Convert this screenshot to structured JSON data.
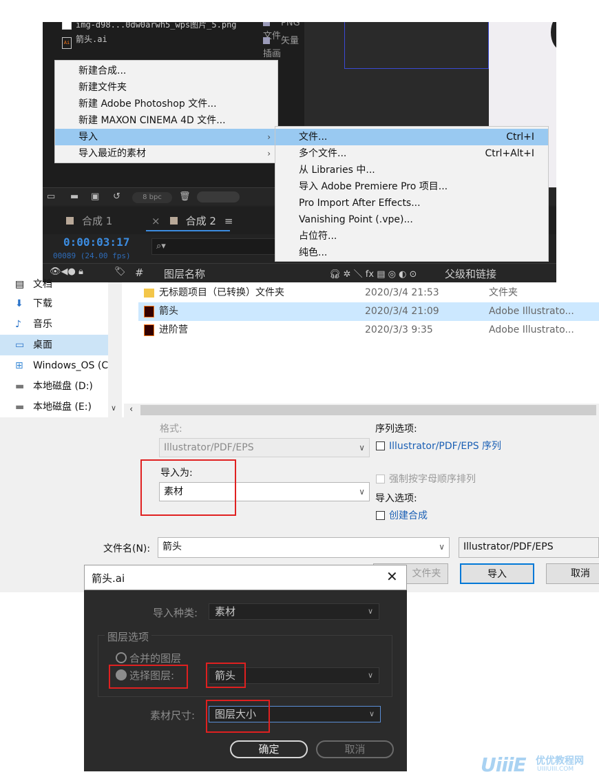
{
  "ae": {
    "project_files": [
      {
        "name": "img-d98...0dw0arwh5_wps图片_5.png",
        "type": "PNG 文件"
      },
      {
        "name": "箭头.ai",
        "type": "矢量插画"
      }
    ],
    "context_menu": [
      "新建合成...",
      "新建文件夹",
      "新建 Adobe Photoshop 文件...",
      "新建 MAXON CINEMA 4D 文件...",
      "导入",
      "导入最近的素材"
    ],
    "submenu": [
      {
        "label": "文件...",
        "shortcut": "Ctrl+I"
      },
      {
        "label": "多个文件...",
        "shortcut": "Ctrl+Alt+I"
      },
      {
        "label": "从 Libraries 中...",
        "shortcut": ""
      },
      {
        "label": "导入 Adobe Premiere Pro 项目...",
        "shortcut": ""
      },
      {
        "label": "Pro Import After Effects...",
        "shortcut": ""
      },
      {
        "label": "Vanishing Point (.vpe)...",
        "shortcut": ""
      },
      {
        "label": "占位符...",
        "shortcut": ""
      },
      {
        "label": "纯色...",
        "shortcut": ""
      }
    ],
    "bpc": "8 bpc",
    "tabs": [
      "合成 1",
      "合成 2"
    ],
    "timecode": "0:00:03:17",
    "fps": "00089 (24.00 fps)",
    "search_glyph": "⌕▾",
    "header": {
      "hash": "#",
      "layer_name": "图层名称",
      "parent": "父级和链接",
      "icons": "🎧︎ ✲ ＼ fx ▤ ◎ ◐ ⊙"
    }
  },
  "explorer": {
    "nav": [
      "文档",
      "下载",
      "音乐",
      "桌面",
      "Windows_OS (C",
      "本地磁盘 (D:)",
      "本地磁盘 (E:)"
    ],
    "files": [
      {
        "name": "无标题项目（已转换）文件夹",
        "date": "2020/3/4 21:53",
        "type": "文件夹"
      },
      {
        "name": "箭头",
        "date": "2020/3/4 21:09",
        "type": "Adobe Illustrato..."
      },
      {
        "name": "进阶营",
        "date": "2020/3/3 9:35",
        "type": "Adobe Illustrato..."
      }
    ]
  },
  "import_dialog": {
    "format_label": "格式:",
    "format_value": "Illustrator/PDF/EPS",
    "import_as_label": "导入为:",
    "import_as_value": "素材",
    "sequence_label": "序列选项:",
    "sequence_checkbox": "Illustrator/PDF/EPS 序列",
    "force_alpha": "强制按字母顺序排列",
    "import_options_label": "导入选项:",
    "create_comp": "创建合成",
    "filename_label": "文件名(N):",
    "filename_value": "箭头",
    "filetype_value": "Illustrator/PDF/EPS",
    "folder_button": "文件夹",
    "import_button": "导入",
    "cancel_button": "取消"
  },
  "ai_dialog": {
    "title": "箭头.ai",
    "import_kind_label": "导入种类:",
    "import_kind_value": "素材",
    "layer_options_label": "图层选项",
    "merged_layers": "合并的图层",
    "choose_layer": "选择图层:",
    "choose_layer_value": "箭头",
    "footage_size_label": "素材尺寸:",
    "footage_size_value": "图层大小",
    "ok": "确定",
    "cancel": "取消"
  },
  "watermark": {
    "logo": "UiiiE",
    "cn": "优优教程网",
    "url": "UIIIUIII.COM"
  },
  "colors": {
    "highlight_red": "#e02020",
    "timecode_blue": "#3c8ce0",
    "menu_highlight": "#99c9f1",
    "link_blue": "#1a5fb4"
  }
}
